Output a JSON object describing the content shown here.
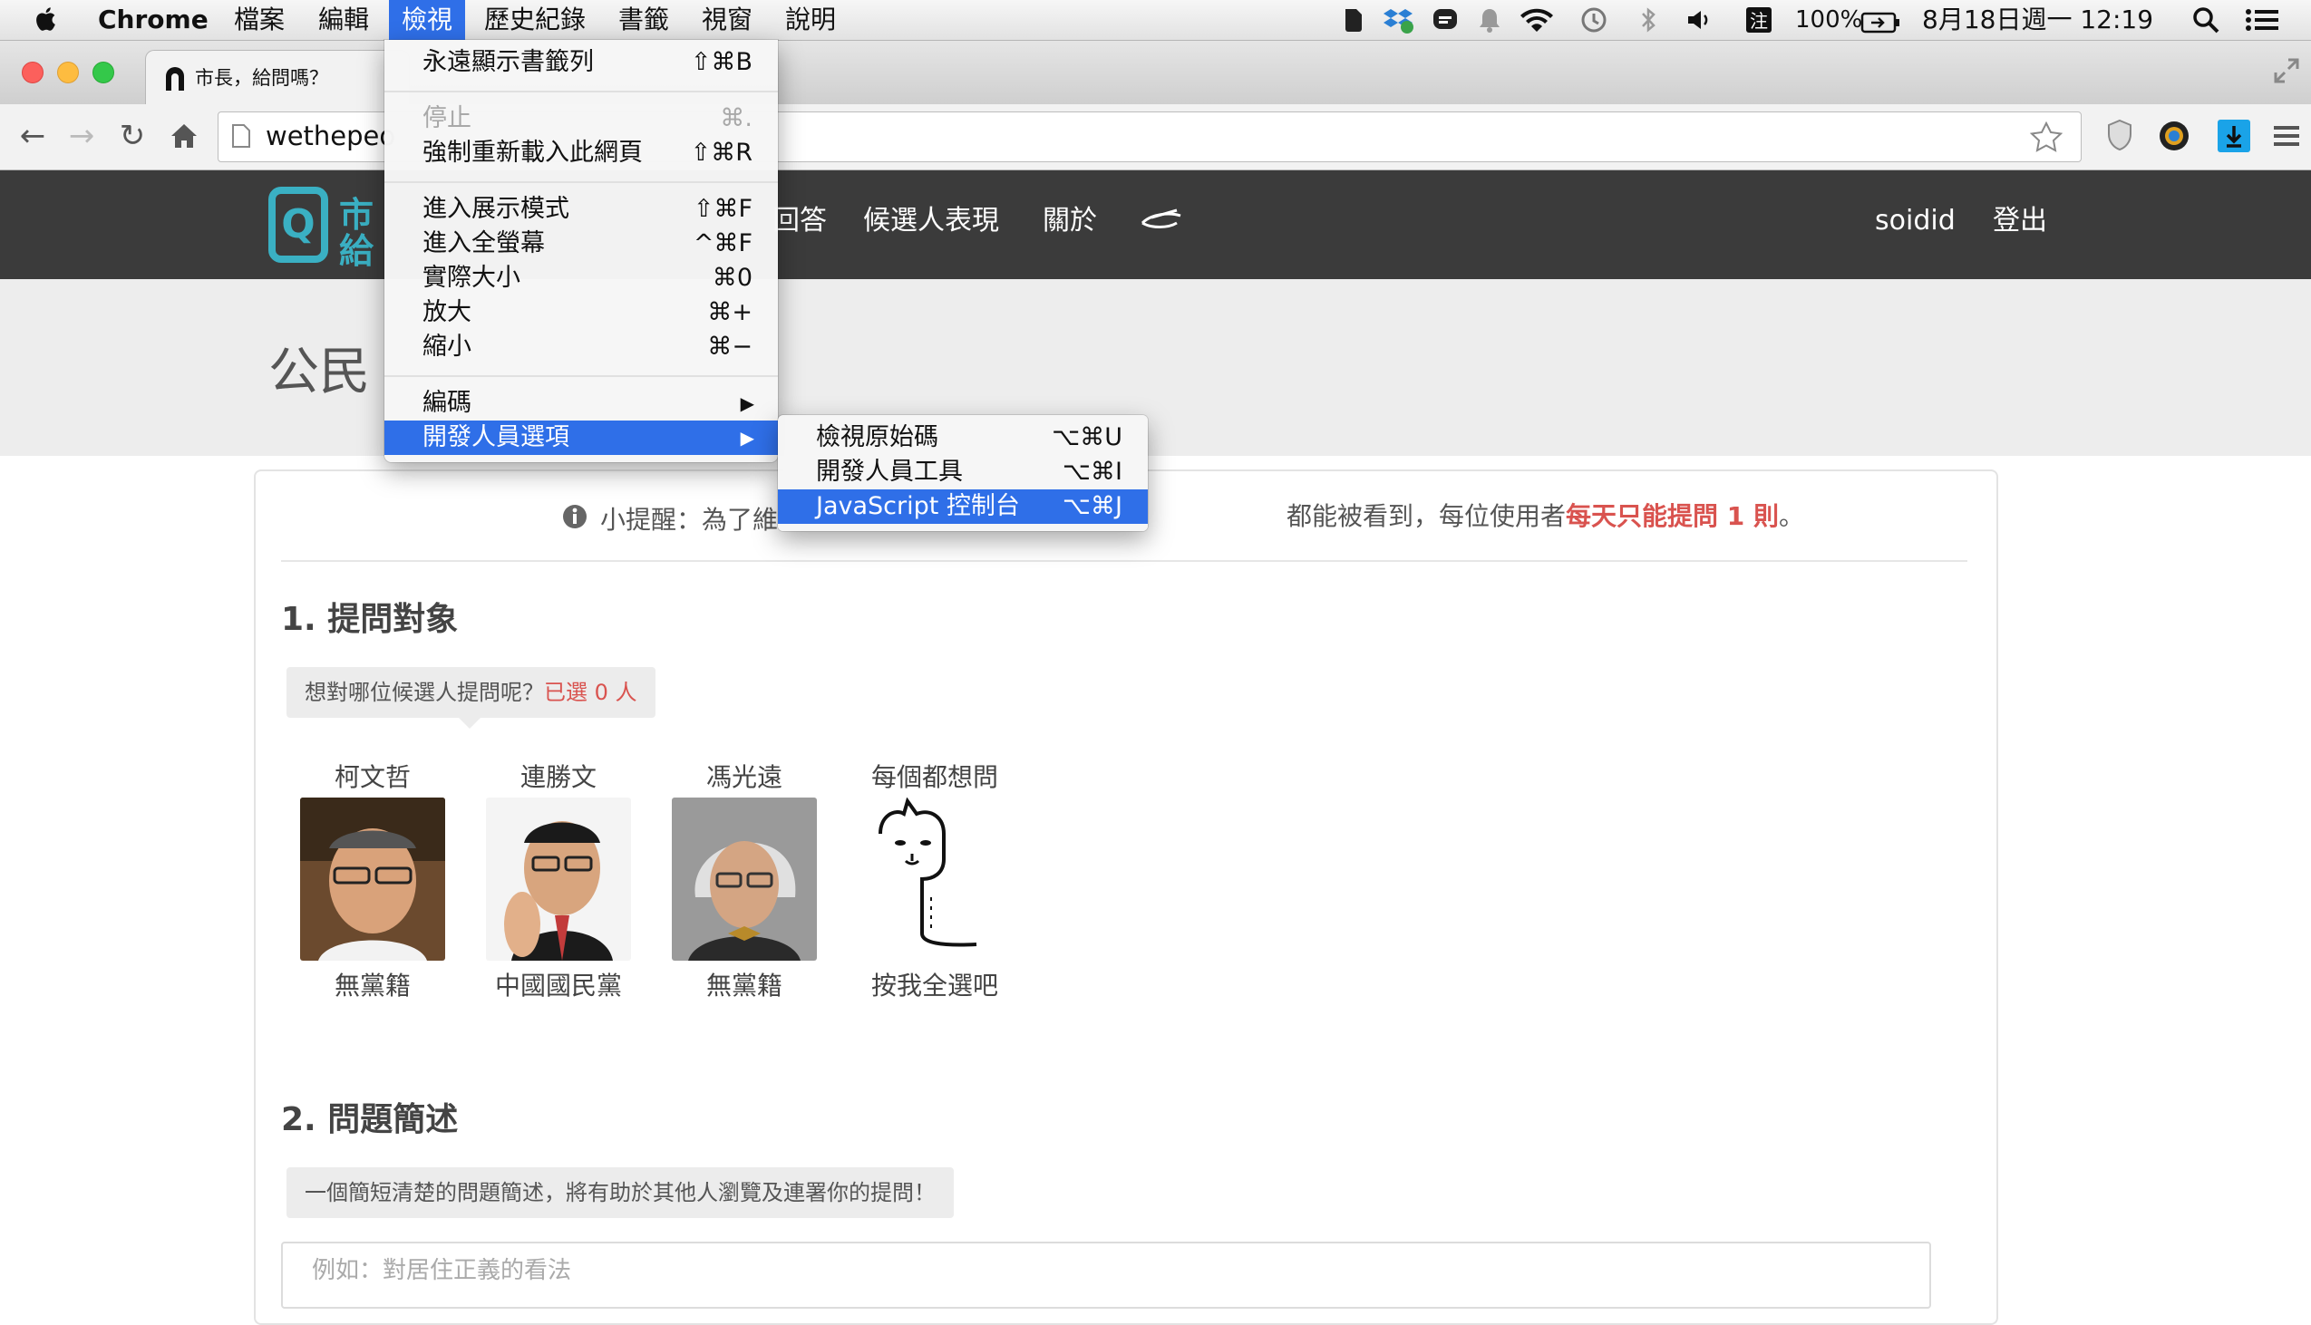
{
  "menubar": {
    "app_name": "Chrome",
    "items": [
      "檔案",
      "編輯",
      "檢視",
      "歷史紀錄",
      "書籤",
      "視窗",
      "說明"
    ],
    "battery": "100%",
    "datetime": "8月18日週一  12:19"
  },
  "browser": {
    "tab_title": "市長，給問嗎？",
    "url": "wethepeo"
  },
  "site": {
    "logo_text_line1": "市",
    "logo_text_line2": "給",
    "nav": [
      "回答",
      "候選人表現",
      "關於"
    ],
    "username": "soidid",
    "logout": "登出",
    "page_title_partial": "公民"
  },
  "view_menu": {
    "items": [
      {
        "label": "永遠顯示書籤列",
        "shortcut": "⇧⌘B"
      },
      {
        "label": "停止",
        "shortcut": "⌘.",
        "disabled": true
      },
      {
        "label": "強制重新載入此網頁",
        "shortcut": "⇧⌘R"
      },
      {
        "label": "進入展示模式",
        "shortcut": "⇧⌘F"
      },
      {
        "label": "進入全螢幕",
        "shortcut": "^⌘F"
      },
      {
        "label": "實際大小",
        "shortcut": "⌘0"
      },
      {
        "label": "放大",
        "shortcut": "⌘+"
      },
      {
        "label": "縮小",
        "shortcut": "⌘−"
      },
      {
        "label": "編碼",
        "submenu": true
      },
      {
        "label": "開發人員選項",
        "submenu": true,
        "selected": true
      }
    ]
  },
  "dev_submenu": {
    "items": [
      {
        "label": "檢視原始碼",
        "shortcut": "⌥⌘U"
      },
      {
        "label": "開發人員工具",
        "shortcut": "⌥⌘I"
      },
      {
        "label": "JavaScript 控制台",
        "shortcut": "⌥⌘J",
        "selected": true
      }
    ]
  },
  "content": {
    "tip_prefix": "小提醒：為了維",
    "tip_middle": "都能被看到，每位使用者",
    "tip_highlight": "每天只能提問 1 則",
    "tip_suffix": "。",
    "section1_title": "1. 提問對象",
    "section1_hint": "想對哪位候選人提問呢？",
    "section1_hint_count": "已選 0 人",
    "candidates": [
      {
        "name": "柯文哲",
        "party": "無黨籍"
      },
      {
        "name": "連勝文",
        "party": "中國國民黨"
      },
      {
        "name": "馮光遠",
        "party": "無黨籍"
      },
      {
        "name": "每個都想問",
        "party": "按我全選吧"
      }
    ],
    "section2_title": "2. 問題簡述",
    "section2_hint": "一個簡短清楚的問題簡述，將有助於其他人瀏覽及連署你的提問！",
    "section2_placeholder": "例如：對居住正義的看法"
  },
  "colors": {
    "menu_highlight": "#2f6fe8",
    "site_header": "#3b3b3b",
    "accent_red": "#d9534f",
    "logo_teal": "#3ab0c3"
  }
}
